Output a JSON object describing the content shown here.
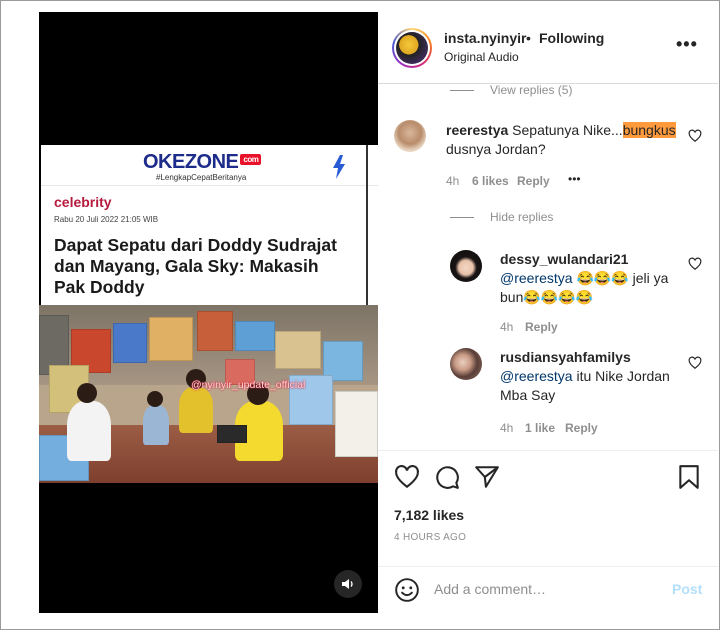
{
  "header": {
    "username": "insta.nyinyir",
    "separator": "•",
    "follow_status": "Following",
    "audio": "Original Audio",
    "more_label": "•••"
  },
  "article": {
    "logo_main": "OKEZONE",
    "logo_suffix": "com",
    "tagline": "#LengkapCepatBeritanya",
    "category": "celebrity",
    "date": "Rabu 20 Juli 2022 21:05 WIB",
    "headline": "Dapat Sepatu dari Doddy Sudrajat dan Mayang, Gala Sky: Makasih Pak Doddy",
    "video_watermark": "@nyinyir_update_official"
  },
  "comments": {
    "view_replies": "View replies (5)",
    "hide_replies": "Hide replies",
    "main": {
      "user": "reerestya",
      "text_before": "Sepatunya Nike...",
      "text_highlight": "bungkus",
      "text_after": " dusnya Jordan?",
      "age": "4h",
      "likes": "6 likes",
      "reply": "Reply",
      "more": "•••"
    },
    "replies": [
      {
        "user": "dessy_wulandari21",
        "mention": "@reerestya",
        "text": " 😂😂😂 jeli ya bun😂😂😂😂",
        "age": "4h",
        "likes": "",
        "reply": "Reply"
      },
      {
        "user": "rusdiansyahfamilys",
        "mention": "@reerestya",
        "text": " itu Nike Jordan Mba Say",
        "age": "4h",
        "likes": "1 like",
        "reply": "Reply"
      }
    ]
  },
  "footer": {
    "likes": "7,182 likes",
    "time": "4 HOURS AGO",
    "comment_placeholder": "Add a comment…",
    "post_label": "Post"
  },
  "colors": {
    "text": "#262626",
    "muted": "#8e8e8e",
    "link": "#00376b",
    "highlight": "#ff9a3c",
    "post_disabled": "#b2dffc"
  }
}
